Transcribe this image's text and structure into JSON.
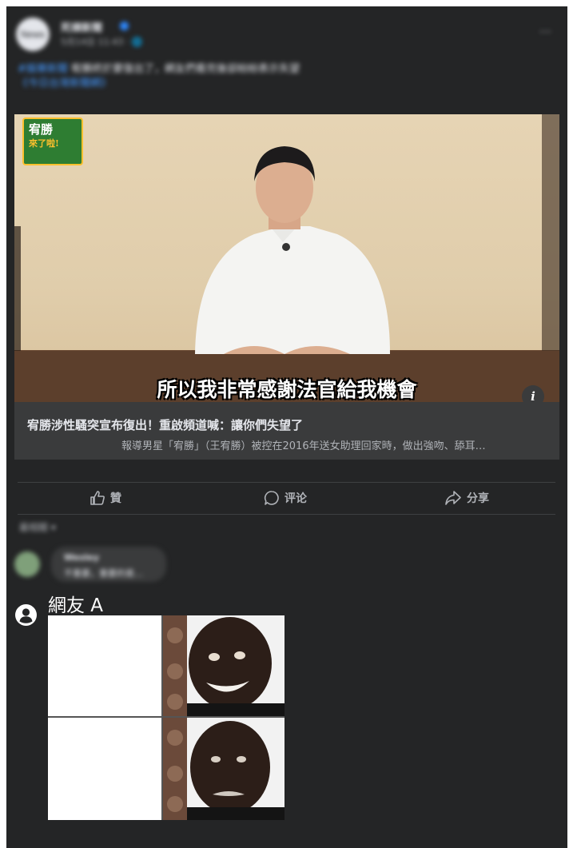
{
  "post": {
    "avatar_label": "News",
    "page_name": "死槓新聞",
    "post_time": "5月14日 11:43 · 🌐",
    "more_label": "···",
    "caption_tag": "#娛樂新聞",
    "caption_text": "宥勝終於要復出了，網友們看完後卻紛紛表示失望",
    "caption_link": "《今日台灣新聞網》"
  },
  "media": {
    "logo_line1": "宥勝",
    "logo_line2": "來了啦!",
    "subtitle": "所以我非常感謝法官給我機會",
    "info_label": "i"
  },
  "link": {
    "title": "宥勝涉性騷突宣布復出！重啟頻道喊：讓你們失望了",
    "description": "報導男星「宥勝」（王宥勝）被控在2016年送女助理回家時，做出強吻、舔耳…"
  },
  "actions": {
    "like": "贊",
    "comment": "评论",
    "share": "分享"
  },
  "comments": {
    "sort_label": "最相關 ▾",
    "first_name": "Wesley",
    "first_text": "不重要，重要的是…"
  },
  "reply": {
    "user_name": "網友 A"
  }
}
